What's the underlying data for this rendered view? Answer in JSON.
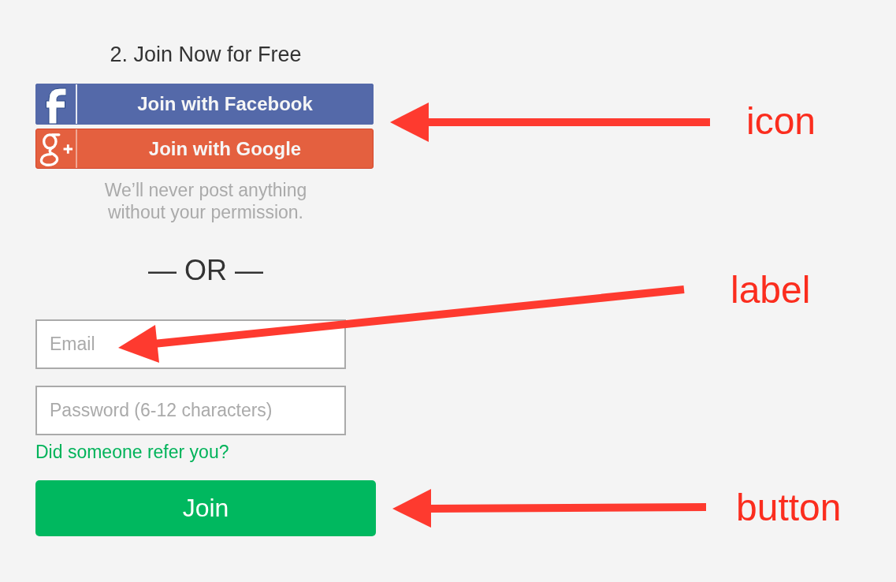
{
  "form": {
    "title": "2. Join Now for Free",
    "social_buttons": [
      {
        "kind": "facebook",
        "label": "Join with Facebook"
      },
      {
        "kind": "google",
        "label": "Join with Google"
      }
    ],
    "privacy_note": "We’ll never post anything without your permission.",
    "divider": "— OR —",
    "fields": [
      {
        "placeholder": "Email"
      },
      {
        "placeholder": "Password (6-12 characters)"
      }
    ],
    "referral_link": "Did someone refer you?",
    "submit_button": "Join"
  },
  "annotations": [
    {
      "label": "icon"
    },
    {
      "label": "label"
    },
    {
      "label": "button"
    }
  ]
}
